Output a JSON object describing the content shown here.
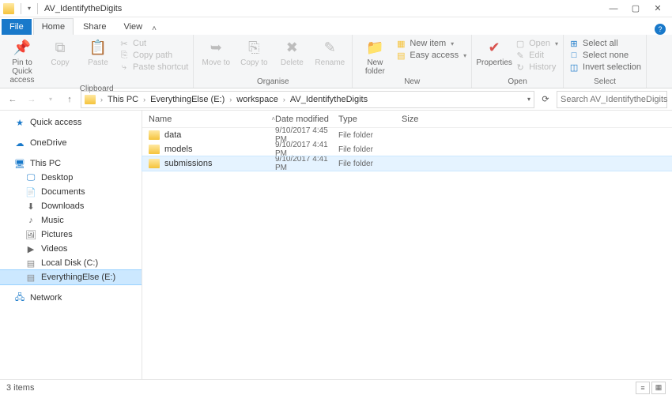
{
  "window": {
    "title": "AV_IdentifytheDigits"
  },
  "tabs": {
    "file": "File",
    "home": "Home",
    "share": "Share",
    "view": "View"
  },
  "ribbon": {
    "clipboard": {
      "label": "Clipboard",
      "pin": "Pin to Quick access",
      "copy": "Copy",
      "paste": "Paste",
      "cut": "Cut",
      "copypath": "Copy path",
      "pasteshortcut": "Paste shortcut"
    },
    "organise": {
      "label": "Organise",
      "moveto": "Move to",
      "copyto": "Copy to",
      "delete": "Delete",
      "rename": "Rename"
    },
    "new": {
      "label": "New",
      "newfolder": "New folder",
      "newitem": "New item",
      "easyaccess": "Easy access"
    },
    "open": {
      "label": "Open",
      "properties": "Properties",
      "open": "Open",
      "edit": "Edit",
      "history": "History"
    },
    "select": {
      "label": "Select",
      "selectall": "Select all",
      "selectnone": "Select none",
      "invert": "Invert selection"
    }
  },
  "breadcrumb": [
    "This PC",
    "EverythingElse (E:)",
    "workspace",
    "AV_IdentifytheDigits"
  ],
  "search": {
    "placeholder": "Search AV_IdentifytheDigits"
  },
  "sidebar": {
    "quickaccess": "Quick access",
    "onedrive": "OneDrive",
    "thispc": "This PC",
    "items": [
      "Desktop",
      "Documents",
      "Downloads",
      "Music",
      "Pictures",
      "Videos",
      "Local Disk (C:)",
      "EverythingElse (E:)"
    ],
    "network": "Network"
  },
  "columns": {
    "name": "Name",
    "date": "Date modified",
    "type": "Type",
    "size": "Size"
  },
  "files": [
    {
      "name": "data",
      "date": "9/10/2017 4:45 PM",
      "type": "File folder",
      "size": ""
    },
    {
      "name": "models",
      "date": "9/10/2017 4:41 PM",
      "type": "File folder",
      "size": ""
    },
    {
      "name": "submissions",
      "date": "9/10/2017 4:41 PM",
      "type": "File folder",
      "size": ""
    }
  ],
  "status": {
    "count": "3 items"
  },
  "colors": {
    "accent": "#1979ca",
    "selection": "#cce8ff"
  }
}
